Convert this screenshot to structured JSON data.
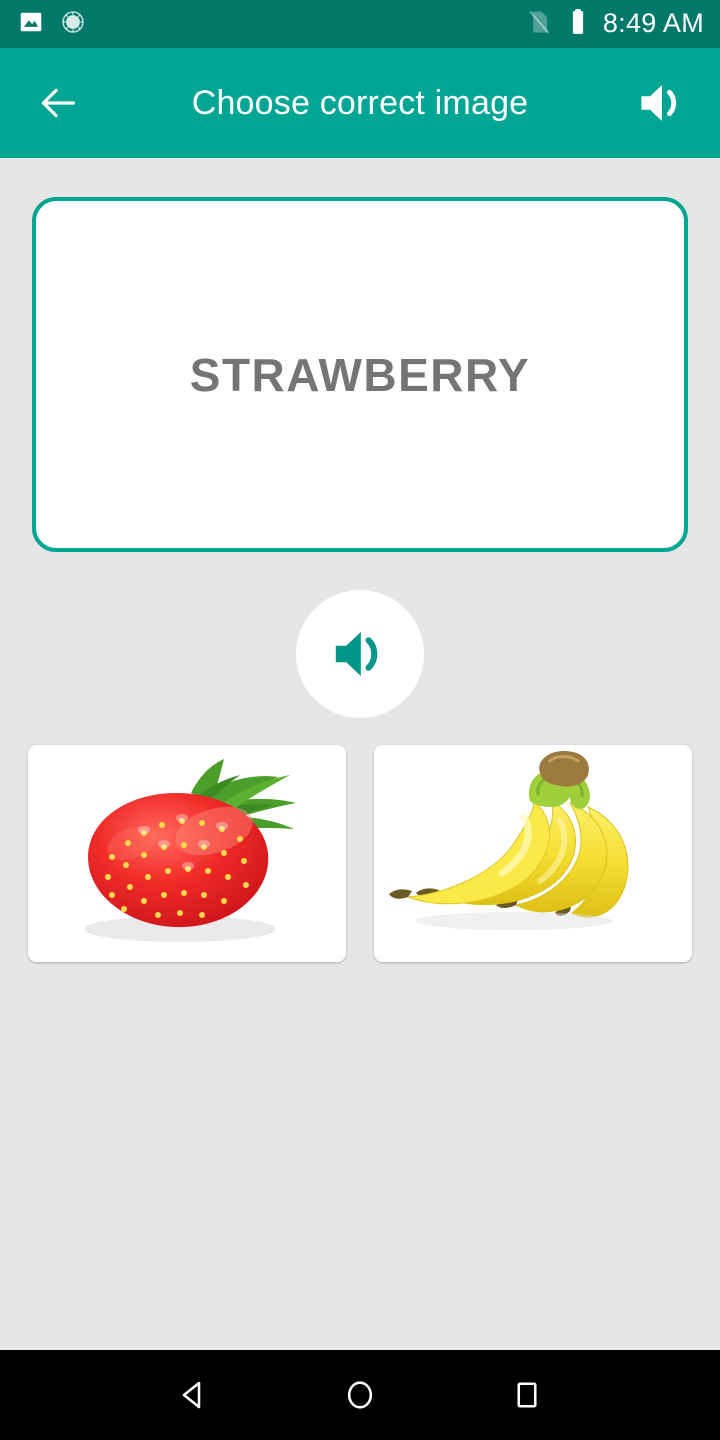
{
  "status_bar": {
    "background_color": "#00796b",
    "left_icons": [
      {
        "name": "image-notification-icon",
        "label": "image"
      },
      {
        "name": "screenshot-progress-icon",
        "label": "progress"
      }
    ],
    "right_icons": [
      {
        "name": "no-sim-icon",
        "label": "no sim"
      },
      {
        "name": "battery-full-icon",
        "label": "battery full"
      }
    ],
    "time": "8:49 AM"
  },
  "app_bar": {
    "background_color": "#00a594",
    "back_label": "Back",
    "back_icon": "arrow-left-icon",
    "title": "Choose correct image",
    "sound_icon": "volume-up-icon",
    "sound_label": "Sound"
  },
  "main": {
    "background_color": "#e6e6e6",
    "word_card": {
      "word": "STRAWBERRY",
      "border_color": "#00a694",
      "text_color": "#757575"
    },
    "play_sound_button": {
      "icon": "volume-up-icon",
      "label": "Play pronunciation",
      "icon_color": "#009688"
    },
    "options": [
      {
        "name": "option-strawberry",
        "label": "Strawberry",
        "art": "strawberry-photo",
        "correct": true
      },
      {
        "name": "option-banana",
        "label": "Bananas",
        "art": "banana-photo",
        "correct": false
      }
    ]
  },
  "nav_bar": {
    "background_color": "#000000",
    "buttons": [
      {
        "name": "nav-back-button",
        "icon": "triangle-back-icon",
        "label": "Back"
      },
      {
        "name": "nav-home-button",
        "icon": "circle-home-icon",
        "label": "Home"
      },
      {
        "name": "nav-recents-button",
        "icon": "square-recents-icon",
        "label": "Recents"
      }
    ]
  }
}
